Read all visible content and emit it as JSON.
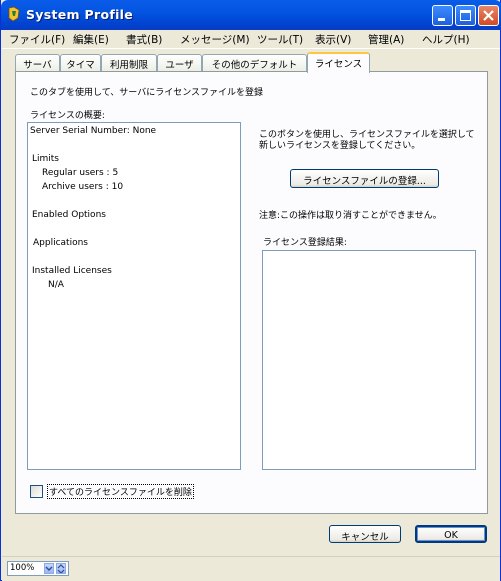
{
  "window": {
    "title": "System Profile"
  },
  "menu": [
    "ファイル(F)",
    "編集(E)",
    "書式(B)",
    "メッセージ(M)",
    "ツール(T)",
    "表示(V)",
    "管理(A)",
    "ヘルプ(H)"
  ],
  "tabs": [
    "サーバ",
    "タイマ",
    "利用制限",
    "ユーザ",
    "その他のデフォルト",
    "ライセンス"
  ],
  "active_tab": "ライセンス",
  "panel": {
    "description": "このタブを使用して、サーバにライセンスファイルを登録",
    "summary_label": "ライセンスの概要:",
    "summary_lines": {
      "serial": "Server Serial Number: None",
      "limits": "Limits",
      "regular": "Regular users : 5",
      "archive": "Archive users : 10",
      "enabled": "Enabled Options",
      "applications": "Applications",
      "installed": "Installed Licenses",
      "na": "N/A"
    },
    "instruction_line1": "このボタンを使用し、ライセンスファイルを選択して",
    "instruction_line2": "新しいライセンスを登録してください。",
    "register_button": "ライセンスファイルの登録...",
    "warning": "注意:この操作は取り消すことができません。",
    "result_label": "ライセンス登録結果:",
    "result_value": "",
    "delete_all_checkbox": "すべてのライセンスファイルを削除",
    "delete_all_checked": false
  },
  "buttons": {
    "cancel": "キャンセル",
    "ok": "OK"
  },
  "status": {
    "zoom": "100%"
  },
  "colors": {
    "title_bar": "#0454e2",
    "tab_highlight": "#ffc83c",
    "panel_bg": "#fcfcfe",
    "window_bg": "#ece9d8"
  }
}
